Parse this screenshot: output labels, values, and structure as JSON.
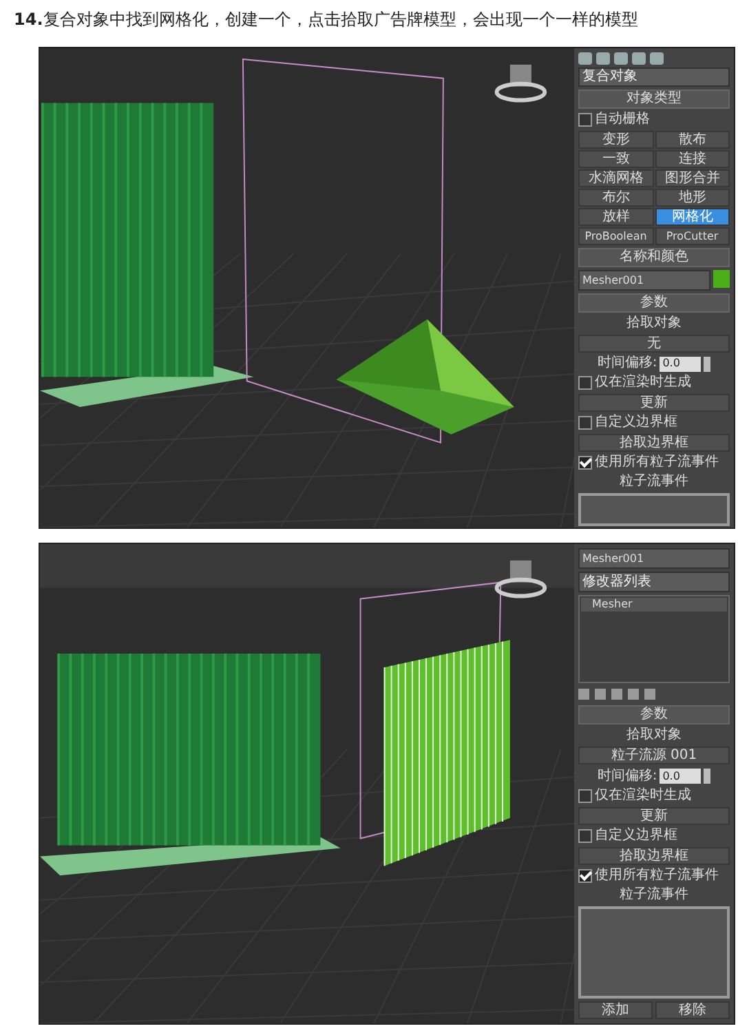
{
  "heading": {
    "number": "14.",
    "text": "复合对象中找到网格化，创建一个，点击拾取广告牌模型，会出现一个一样的模型"
  },
  "screenshots": [
    {
      "kind": "pyramid",
      "panel": [
        {
          "kind": "dropdown",
          "value": "复合对象"
        },
        {
          "kind": "rollout",
          "title": "对象类型"
        },
        {
          "kind": "checkbox",
          "label": "自动栅格",
          "checked": false
        },
        {
          "kind": "grid",
          "buttons": [
            {
              "label": "变形",
              "selected": false
            },
            {
              "label": "散布",
              "selected": false
            },
            {
              "label": "一致",
              "selected": false
            },
            {
              "label": "连接",
              "selected": false
            },
            {
              "label": "水滴网格",
              "selected": false
            },
            {
              "label": "图形合并",
              "selected": false
            },
            {
              "label": "布尔",
              "selected": false
            },
            {
              "label": "地形",
              "selected": false
            },
            {
              "label": "放样",
              "selected": false
            },
            {
              "label": "网格化",
              "selected": true
            },
            {
              "label": "ProBoolean",
              "selected": false
            },
            {
              "label": "ProCutter",
              "selected": false
            }
          ]
        },
        {
          "kind": "rollout",
          "title": "名称和颜色"
        },
        {
          "kind": "name",
          "value": "Mesher001"
        },
        {
          "kind": "rollout",
          "title": "参数"
        },
        {
          "kind": "label",
          "text": "拾取对象"
        },
        {
          "kind": "button",
          "label": "无"
        },
        {
          "kind": "spinner",
          "label": "时间偏移:",
          "value": "0.0"
        },
        {
          "kind": "checkbox",
          "label": "仅在渲染时生成",
          "checked": false
        },
        {
          "kind": "button",
          "label": "更新"
        },
        {
          "kind": "checkbox",
          "label": "自定义边界框",
          "checked": false
        },
        {
          "kind": "button",
          "label": "拾取边界框"
        },
        {
          "kind": "checkbox",
          "label": "使用所有粒子流事件",
          "checked": true
        },
        {
          "kind": "label",
          "text": "粒子流事件"
        },
        {
          "kind": "box"
        }
      ]
    },
    {
      "kind": "walls",
      "panel": [
        {
          "kind": "field",
          "value": "Mesher001"
        },
        {
          "kind": "dropdown",
          "value": "修改器列表"
        },
        {
          "kind": "stack",
          "items": [
            "Mesher"
          ]
        },
        {
          "kind": "stackbar"
        },
        {
          "kind": "rollout",
          "title": "参数"
        },
        {
          "kind": "label",
          "text": "拾取对象"
        },
        {
          "kind": "button",
          "label": "粒子流源 001"
        },
        {
          "kind": "spinner",
          "label": "时间偏移:",
          "value": "0.0"
        },
        {
          "kind": "checkbox",
          "label": "仅在渲染时生成",
          "checked": false
        },
        {
          "kind": "button",
          "label": "更新"
        },
        {
          "kind": "checkbox",
          "label": "自定义边界框",
          "checked": false
        },
        {
          "kind": "button",
          "label": "拾取边界框"
        },
        {
          "kind": "checkbox",
          "label": "使用所有粒子流事件",
          "checked": true
        },
        {
          "kind": "label",
          "text": "粒子流事件"
        },
        {
          "kind": "box"
        },
        {
          "kind": "pair",
          "buttons": [
            "添加",
            "移除"
          ]
        }
      ]
    }
  ]
}
